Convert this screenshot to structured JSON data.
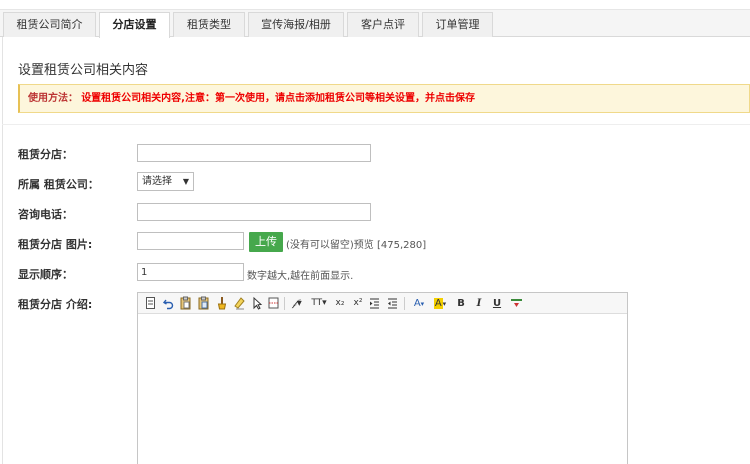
{
  "tabs": [
    {
      "label": "租赁公司简介",
      "active": false
    },
    {
      "label": "分店设置",
      "active": true
    },
    {
      "label": "租赁类型",
      "active": false
    },
    {
      "label": "宣传海报/相册",
      "active": false
    },
    {
      "label": "客户点评",
      "active": false
    },
    {
      "label": "订单管理",
      "active": false
    }
  ],
  "page": {
    "title": "设置租赁公司相关内容",
    "notice_label": "使用方法：",
    "notice_text": "设置租赁公司相关内容,注意：第一次使用，请点击添加租赁公司等相关设置，并点击保存"
  },
  "form": {
    "branch_label": "租赁分店：",
    "company_label": "所属 租赁公司：",
    "company_selected": "请选择",
    "phone_label": "咨询电话：",
    "image_label": "租赁分店 图片:",
    "upload_label": "上传",
    "image_hint": "(没有可以留空)预览 [475,280]",
    "order_label": "显示顺序：",
    "order_value": "1",
    "order_hint": "数字越大,越在前面显示.",
    "intro_label": "租赁分店 介绍:"
  },
  "editor_toolbar": {
    "font_family": "𝒻",
    "font_size": "TT",
    "subscript": "x₂",
    "superscript": "x²",
    "font_color": "A",
    "bg_color": "A",
    "bold": "B",
    "italic": "I",
    "underline": "U"
  },
  "colors": {
    "upload_button": "#46a84c",
    "notice_text": "#e00000",
    "notice_bg": "#fdf6dc",
    "highlight": "#f4d000"
  }
}
